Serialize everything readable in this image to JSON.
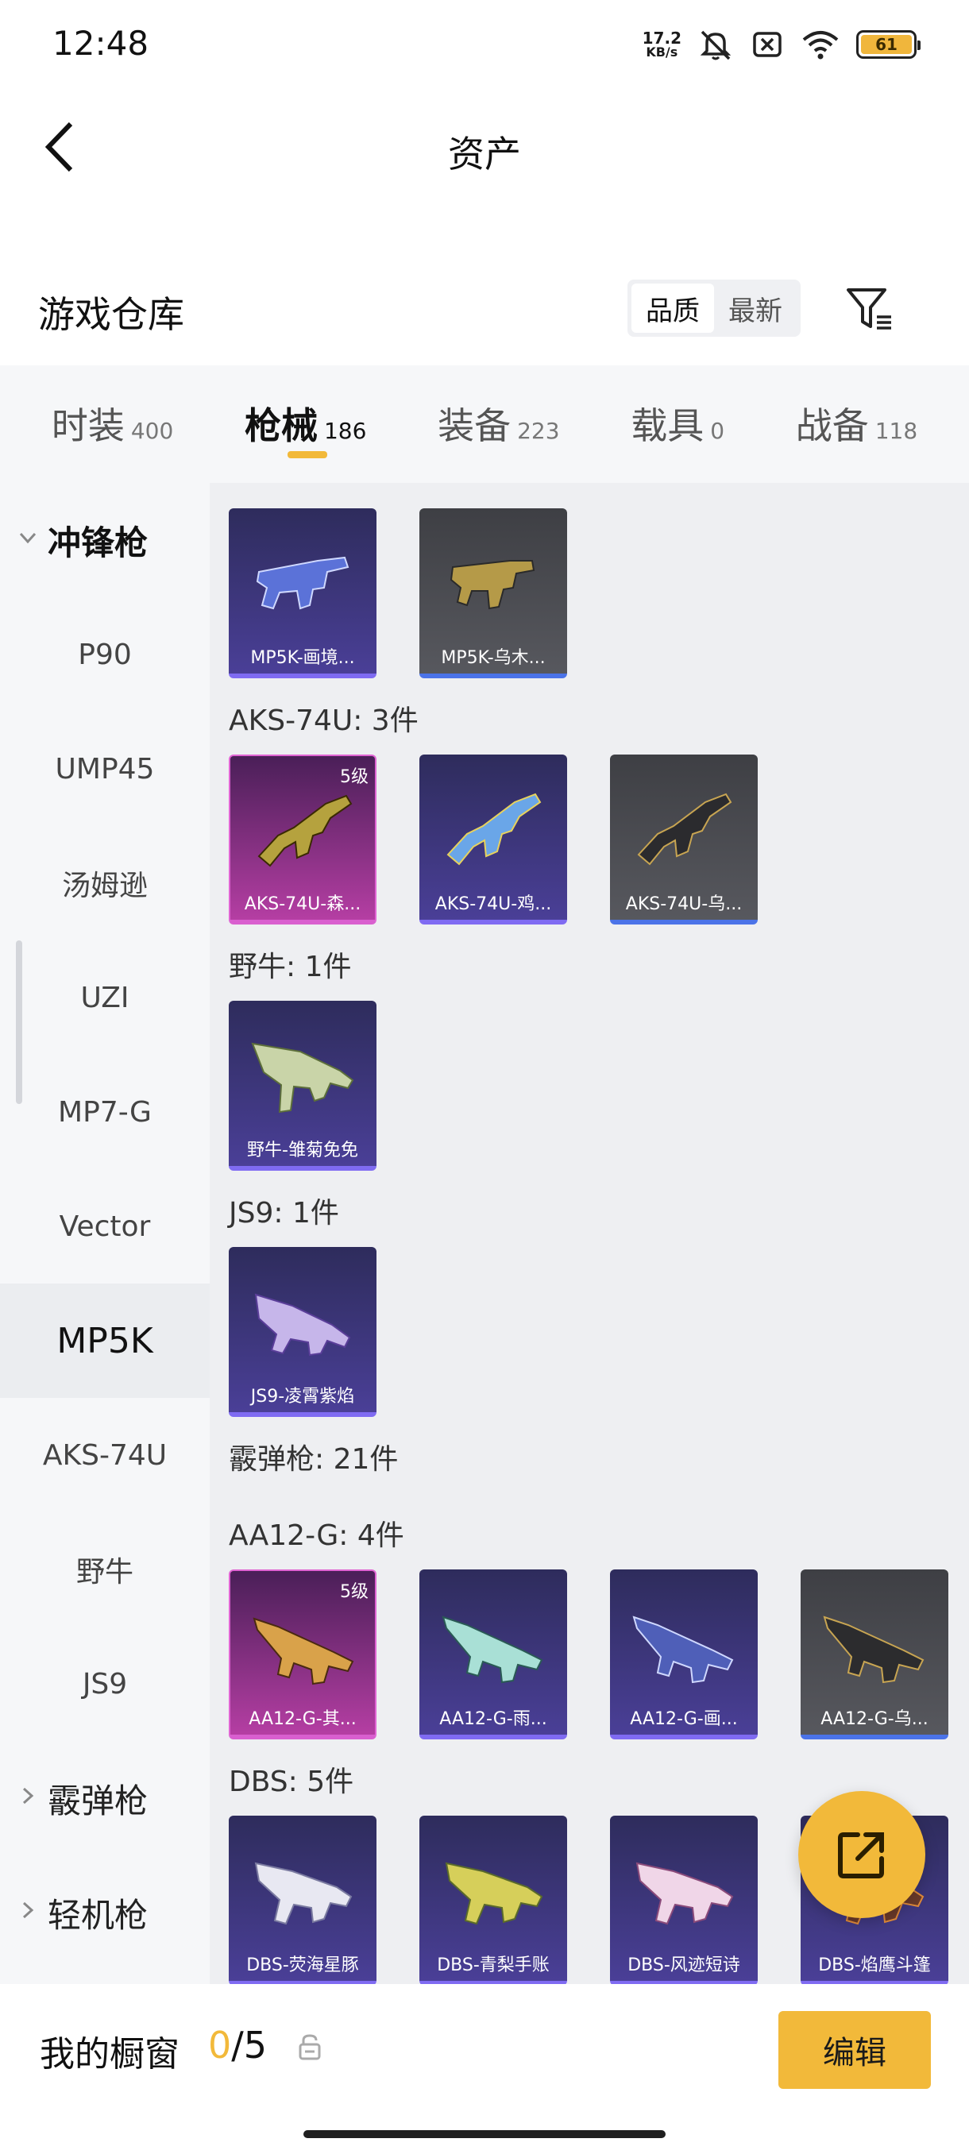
{
  "status_bar": {
    "time": "12:48",
    "net_speed_value": "17.2",
    "net_speed_unit": "KB/s",
    "battery_level": "61",
    "icons": [
      "mute-bell-icon",
      "sim-off-icon",
      "wifi-icon",
      "battery-icon"
    ]
  },
  "header": {
    "title": "资产"
  },
  "section": {
    "title": "游戏仓库",
    "sort_options": [
      "品质",
      "最新"
    ],
    "active_sort": "品质"
  },
  "tabs": [
    {
      "label": "时装",
      "count": "400"
    },
    {
      "label": "枪械",
      "count": "186"
    },
    {
      "label": "装备",
      "count": "223"
    },
    {
      "label": "载具",
      "count": "0"
    },
    {
      "label": "战备",
      "count": "118"
    }
  ],
  "sidebar": {
    "items": [
      {
        "label": "冲锋枪",
        "type": "group"
      },
      {
        "label": "P90"
      },
      {
        "label": "UMP45"
      },
      {
        "label": "汤姆逊"
      },
      {
        "label": "UZI"
      },
      {
        "label": "MP7-G"
      },
      {
        "label": "Vector"
      },
      {
        "label": "MP5K"
      },
      {
        "label": "AKS-74U"
      },
      {
        "label": "野牛"
      },
      {
        "label": "JS9"
      },
      {
        "label": "霰弹枪",
        "type": "group"
      },
      {
        "label": "轻机枪",
        "type": "group"
      }
    ]
  },
  "content": {
    "groups": [
      {
        "label": "AKS-74U: 3件"
      },
      {
        "label": "野牛: 1件"
      },
      {
        "label": "JS9: 1件"
      },
      {
        "label": "霰弹枪: 21件"
      },
      {
        "label": "AA12-G: 4件"
      },
      {
        "label": "DBS: 5件"
      }
    ],
    "cards": [
      {
        "label": "MP5K-画境...",
        "rarity": "purple"
      },
      {
        "label": "MP5K-乌木...",
        "rarity": "gray"
      },
      {
        "label": "AKS-74U-森...",
        "rarity": "pink",
        "level": "5级"
      },
      {
        "label": "AKS-74U-鸡...",
        "rarity": "purple"
      },
      {
        "label": "AKS-74U-乌...",
        "rarity": "gray"
      },
      {
        "label": "野牛-雏菊免免",
        "rarity": "purple"
      },
      {
        "label": "JS9-凌霄紫焰",
        "rarity": "purple"
      },
      {
        "label": "AA12-G-其...",
        "rarity": "pink",
        "level": "5级"
      },
      {
        "label": "AA12-G-雨...",
        "rarity": "purple"
      },
      {
        "label": "AA12-G-画...",
        "rarity": "purple"
      },
      {
        "label": "AA12-G-乌...",
        "rarity": "gray"
      },
      {
        "label": "DBS-荧海星豚",
        "rarity": "purple"
      },
      {
        "label": "DBS-青梨手账",
        "rarity": "purple"
      },
      {
        "label": "DBS-风迹短诗",
        "rarity": "purple"
      },
      {
        "label": "DBS-焰鹰斗篷",
        "rarity": "purple"
      }
    ]
  },
  "bottom_bar": {
    "label": "我的橱窗",
    "current": "0",
    "separator": "/",
    "total": "5",
    "edit_label": "编辑"
  },
  "colors": {
    "accent": "#f2b93a",
    "rarity_purple": "#7f6bf2",
    "rarity_pink": "#d95fcf",
    "rarity_gray": "#4b73e8"
  }
}
